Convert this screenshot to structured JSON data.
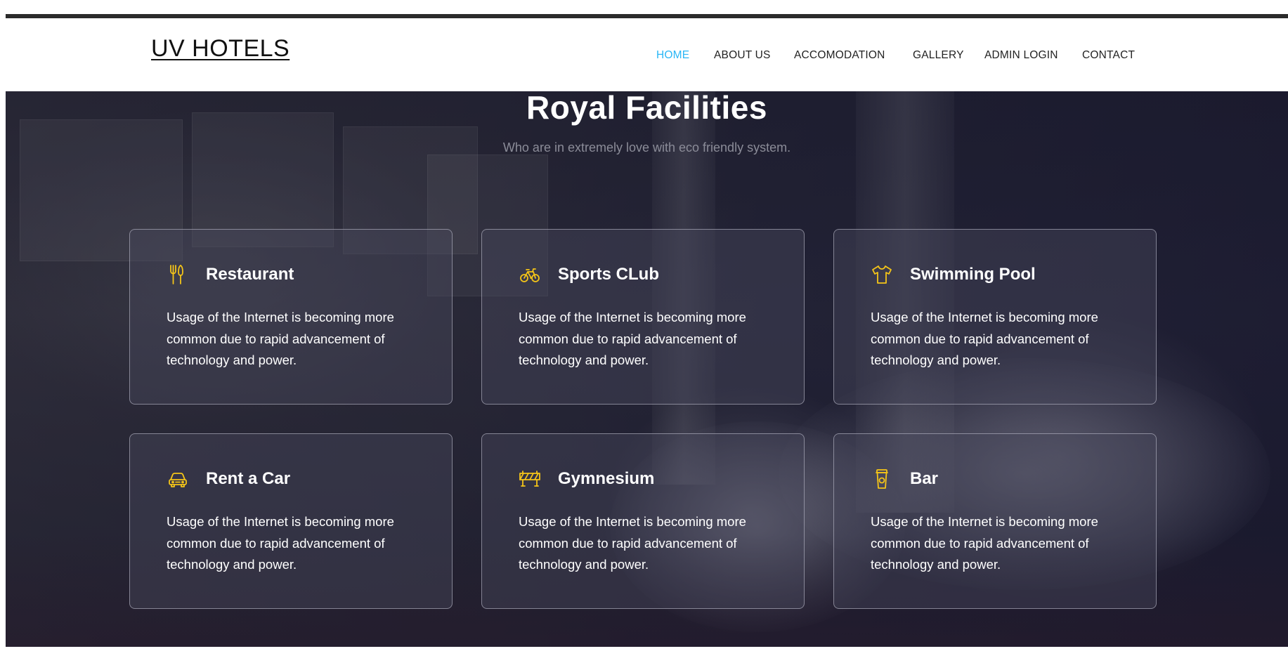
{
  "brand": {
    "logo_text": "UV HOTELS"
  },
  "nav": {
    "items": [
      {
        "label": "HOME",
        "active": true
      },
      {
        "label": "ABOUT US",
        "active": false
      },
      {
        "label": "ACCOMODATION",
        "active": false
      },
      {
        "label": "GALLERY",
        "active": false
      },
      {
        "label": "ADMIN LOGIN",
        "active": false
      },
      {
        "label": "CONTACT",
        "active": false
      }
    ]
  },
  "facilities": {
    "title": "Royal Facilities",
    "subtitle": "Who are in extremely love with eco friendly system.",
    "cards": [
      {
        "title": "Restaurant",
        "icon": "cutlery-icon",
        "text": "Usage of the Internet is becoming more common due to rapid advancement of technology and power."
      },
      {
        "title": "Sports CLub",
        "icon": "bicycle-icon",
        "text": "Usage of the Internet is becoming more common due to rapid advancement of technology and power."
      },
      {
        "title": "Swimming Pool",
        "icon": "shirt-icon",
        "text": "Usage of the Internet is becoming more common due to rapid advancement of technology and power."
      },
      {
        "title": "Rent a Car",
        "icon": "car-icon",
        "text": "Usage of the Internet is becoming more common due to rapid advancement of technology and power."
      },
      {
        "title": "Gymnesium",
        "icon": "barrier-icon",
        "text": "Usage of the Internet is becoming more common due to rapid advancement of technology and power."
      },
      {
        "title": "Bar",
        "icon": "cup-icon",
        "text": "Usage of the Internet is becoming more common due to rapid advancement of technology and power."
      }
    ]
  },
  "colors": {
    "accent": "#29b6f6",
    "icon": "#f5c518",
    "heading_text": "#ffffff",
    "subtitle_text": "#8b8c98",
    "nav_text": "#222222",
    "top_rule": "#2b2b2b"
  }
}
